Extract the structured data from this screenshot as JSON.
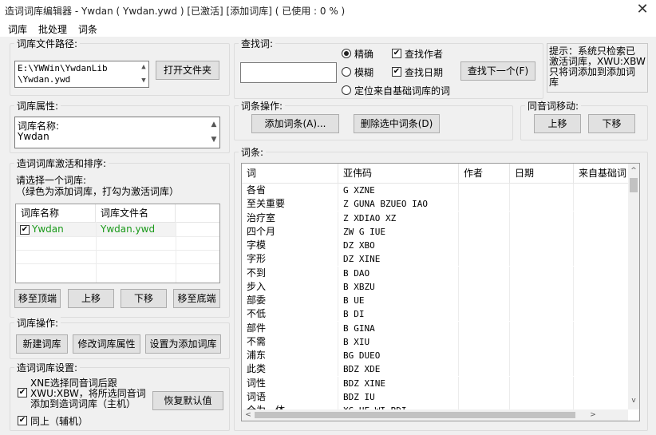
{
  "window": {
    "title": "造词词库编辑器 - Ywdan ( Ywdan.ywd ) [已激活] [添加词库] ( 已使用 : 0 % )"
  },
  "menu": [
    "词库",
    "批处理",
    "词条"
  ],
  "library_path": {
    "group_label": "词库文件路径:",
    "path_line1": "E:\\YWWin\\YwdanLib",
    "path_line2": "\\Ywdan.ywd",
    "open_folder_button": "打开文件夹"
  },
  "library_props": {
    "group_label": "词库属性:",
    "line1": "词库名称:",
    "line2": "Ywdan"
  },
  "activate_sort": {
    "group_label": "造词词库激活和排序:",
    "hint_line1": "请选择一个词库:",
    "hint_line2": "（绿色为添加词库，打勾为激活词库）",
    "col_name": "词库名称",
    "col_file": "词库文件名",
    "rows": [
      {
        "name": "Ywdan",
        "file": "Ywdan.ywd",
        "checked": true
      }
    ],
    "btn_top": "移至顶端",
    "btn_up": "上移",
    "btn_down": "下移",
    "btn_bottom": "移至底端",
    "green": "#1a9a1a"
  },
  "library_ops": {
    "group_label": "词库操作:",
    "btn_new": "新建词库",
    "btn_edit": "修改词库属性",
    "btn_set_add": "设置为添加词库"
  },
  "settings": {
    "group_label": "造词词库设置:",
    "opt1_line1": "XNE选择同音词后跟",
    "opt1_line2": "XWU:XBW，将所选同音词",
    "opt1_line3": "添加到造词词库（主机）",
    "opt2": "同上（辅机）",
    "btn_restore": "恢复默认值"
  },
  "search": {
    "group_label": "查找词:",
    "input_value": "",
    "radio_exact": "精确",
    "radio_fuzzy": "模糊",
    "radio_locate": "定位来自基础词库的词",
    "chk_author": "查找作者",
    "chk_date": "查找日期",
    "btn_next": "查找下一个(F)"
  },
  "tip": {
    "line1": "提示：系统只检索已",
    "line2": "激活词库，XWU:XBW",
    "line3": "只将词添加到添加词",
    "line4": "库"
  },
  "entry_ops": {
    "group_label": "词条操作:",
    "btn_add": "添加词条(A)...",
    "btn_delete": "删除选中词条(D)"
  },
  "homophone": {
    "group_label": "同音词移动:",
    "btn_up": "上移",
    "btn_down": "下移"
  },
  "entries": {
    "group_label": "词条:",
    "columns": [
      "词",
      "亚伟码",
      "作者",
      "日期",
      "来自基础词"
    ],
    "rows": [
      {
        "word": "各省",
        "code": "G XZNE"
      },
      {
        "word": "至关重要",
        "code": "Z GUNA BZUEO IAO"
      },
      {
        "word": "治疗室",
        "code": "Z XDIAO XZ"
      },
      {
        "word": "四个月",
        "code": "ZW G IUE"
      },
      {
        "word": "字模",
        "code": "DZ XBO"
      },
      {
        "word": "字形",
        "code": "DZ XINE"
      },
      {
        "word": "不到",
        "code": "B DAO"
      },
      {
        "word": "步入",
        "code": "B XBZU"
      },
      {
        "word": "部委",
        "code": "B UE"
      },
      {
        "word": "不低",
        "code": "B DI"
      },
      {
        "word": "部件",
        "code": "B GINA"
      },
      {
        "word": "不需",
        "code": "B XIU"
      },
      {
        "word": "浦东",
        "code": "BG DUEO"
      },
      {
        "word": "此类",
        "code": "BDZ XDE"
      },
      {
        "word": "词性",
        "code": "BDZ XINE"
      },
      {
        "word": "词语",
        "code": "BDZ IU"
      },
      {
        "word": "全为一体",
        "code": "XG UE WI BDI"
      }
    ]
  }
}
